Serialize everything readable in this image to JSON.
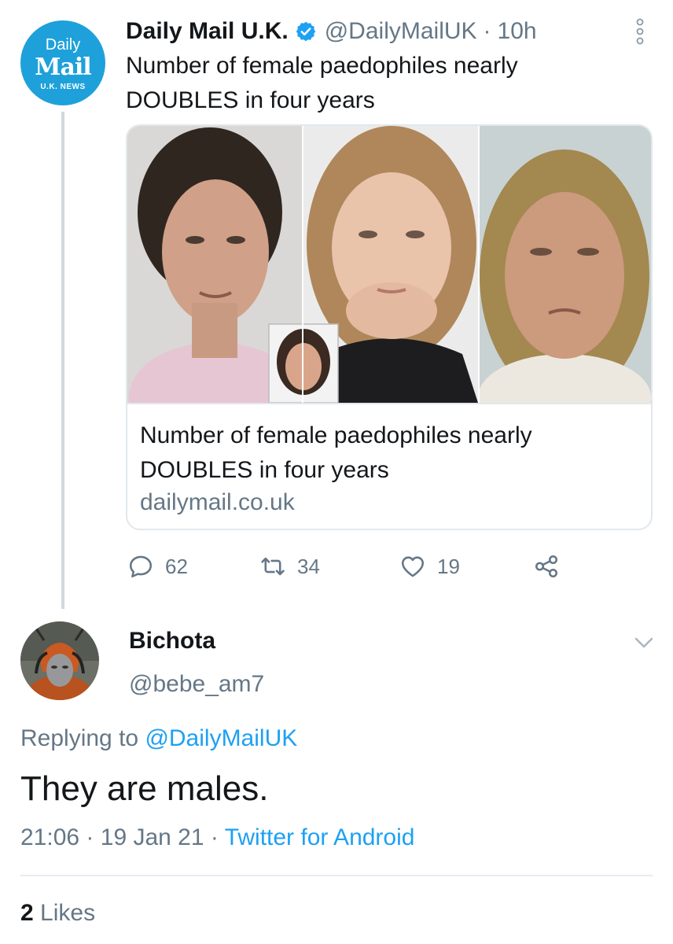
{
  "parent_tweet": {
    "avatar": {
      "line1": "Daily",
      "line2": "Mail",
      "line3": "U.K. NEWS"
    },
    "display_name": "Daily Mail U.K.",
    "handle": "@DailyMailUK",
    "separator": "·",
    "time": "10h",
    "text": "Number of female paedophiles nearly DOUBLES in four years",
    "card": {
      "title": "Number of female paedophiles nearly DOUBLES in four years",
      "domain": "dailymail.co.uk"
    },
    "actions": {
      "replies": "62",
      "retweets": "34",
      "likes": "19"
    }
  },
  "reply_tweet": {
    "display_name": "Bichota",
    "handle": "@bebe_am7",
    "replying_prefix": "Replying to ",
    "replying_to": "@DailyMailUK",
    "text": "They are males.",
    "time": "21:06",
    "sep1": "·",
    "date": "19 Jan 21",
    "sep2": "·",
    "source": "Twitter for Android",
    "likes_count": "2",
    "likes_label": "Likes"
  },
  "colors": {
    "brand_blue": "#1da1f2",
    "daily_mail_blue": "#1ea1da",
    "muted_text": "#657786",
    "border": "#e1e8ed"
  },
  "icons": {
    "verified": "verified-badge-icon",
    "more": "more-vertical-icon",
    "reply": "reply-icon",
    "retweet": "retweet-icon",
    "like": "heart-icon",
    "share": "share-icon",
    "chevron": "chevron-down-icon"
  }
}
